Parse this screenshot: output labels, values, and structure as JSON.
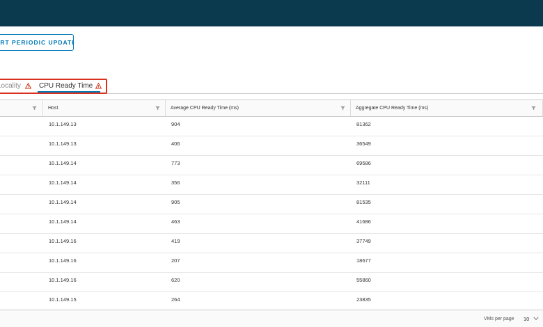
{
  "toolbar": {
    "update_button_label": "START PERIODIC UPDATE"
  },
  "tabs": [
    {
      "label": "Locality",
      "warning": true
    },
    {
      "label": "CPU Ready Time",
      "warning": true,
      "active": true
    }
  ],
  "table": {
    "columns": [
      "",
      "Host",
      "Average CPU Ready Time (ms)",
      "Aggregate CPU Ready Time (ms)"
    ],
    "rows": [
      {
        "host": "10.1.149.13",
        "avg": "904",
        "agg": "81362"
      },
      {
        "host": "10.1.149.13",
        "avg": "406",
        "agg": "36549"
      },
      {
        "host": "10.1.149.14",
        "avg": "773",
        "agg": "69586"
      },
      {
        "host": "10.1.149.14",
        "avg": "356",
        "agg": "32111"
      },
      {
        "host": "10.1.149.14",
        "avg": "905",
        "agg": "81535"
      },
      {
        "host": "10.1.149.14",
        "avg": "463",
        "agg": "41686"
      },
      {
        "host": "10.1.149.16",
        "avg": "419",
        "agg": "37749"
      },
      {
        "host": "10.1.149.16",
        "avg": "207",
        "agg": "18677"
      },
      {
        "host": "10.1.149.16",
        "avg": "620",
        "agg": "55860"
      },
      {
        "host": "10.1.149.15",
        "avg": "264",
        "agg": "23835"
      }
    ]
  },
  "footer": {
    "per_page_label": "VMs per page",
    "per_page_value": "10"
  },
  "colors": {
    "header_bar": "#0b3a4f",
    "accent": "#0079b8",
    "highlight": "#d9301f",
    "warning": "#c92100"
  }
}
